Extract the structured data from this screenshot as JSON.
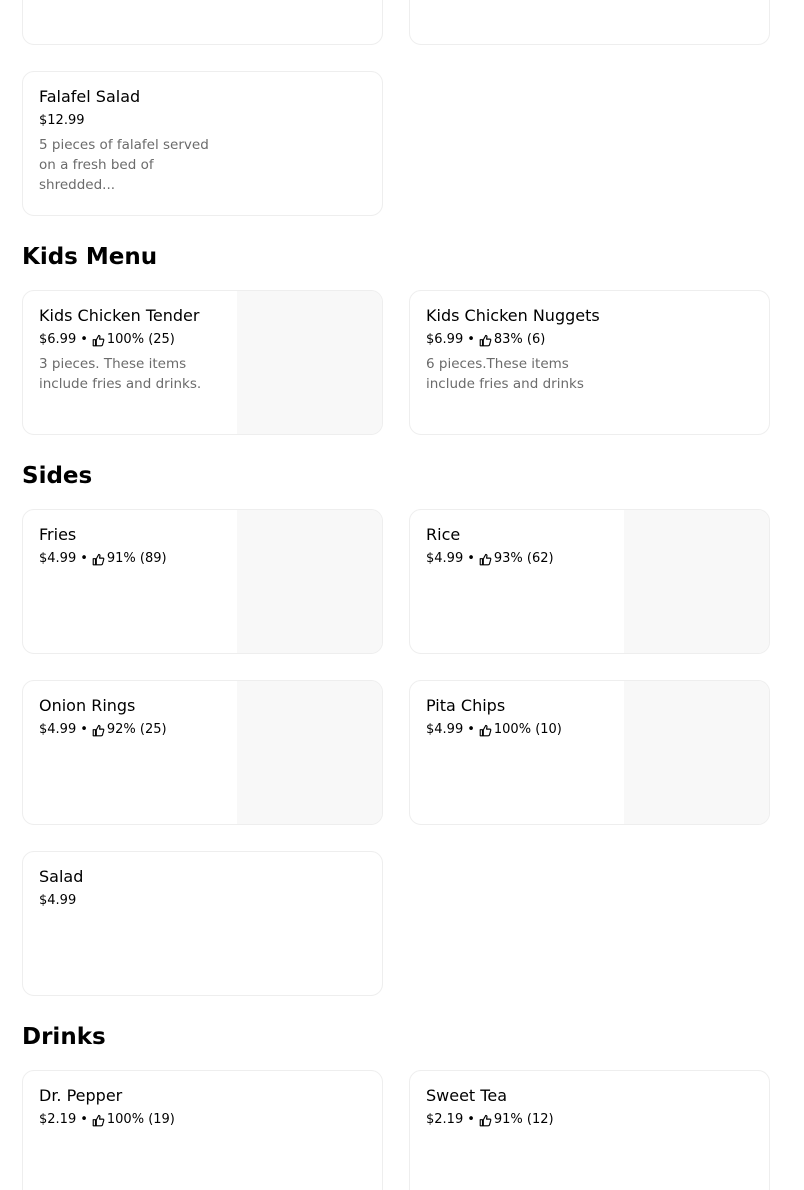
{
  "top_cards": {
    "left_cutoff_text": "",
    "right_cutoff_text": ""
  },
  "salads_extra": {
    "name": "Falafel Salad",
    "price": "$12.99",
    "description": "5 pieces of falafel served on a fresh bed of shredded..."
  },
  "sections": {
    "kids": {
      "title": "Kids Menu",
      "items": [
        {
          "name": "Kids Chicken Tender",
          "price": "$6.99",
          "sep": "•",
          "rating": "100% (25)",
          "description": "3 pieces. These items include fries and drinks."
        },
        {
          "name": "Kids Chicken Nuggets",
          "price": "$6.99",
          "sep": "•",
          "rating": "83% (6)",
          "description": "6 pieces.These items include fries and drinks"
        }
      ]
    },
    "sides": {
      "title": "Sides",
      "items": [
        {
          "name": "Fries",
          "price": "$4.99",
          "sep": "•",
          "rating": "91% (89)"
        },
        {
          "name": "Rice",
          "price": "$4.99",
          "sep": "•",
          "rating": "93% (62)"
        },
        {
          "name": "Onion Rings",
          "price": "$4.99",
          "sep": "•",
          "rating": "92% (25)"
        },
        {
          "name": "Pita Chips",
          "price": "$4.99",
          "sep": "•",
          "rating": "100% (10)"
        },
        {
          "name": "Salad",
          "price": "$4.99"
        }
      ]
    },
    "drinks": {
      "title": "Drinks",
      "items": [
        {
          "name": "Dr. Pepper",
          "price": "$2.19",
          "sep": "•",
          "rating": "100% (19)"
        },
        {
          "name": "Sweet Tea",
          "price": "$2.19",
          "sep": "•",
          "rating": "91% (12)"
        }
      ]
    }
  },
  "icons": {
    "rating": "thumbs-up-icon"
  },
  "colors": {
    "text_primary": "#000000",
    "text_secondary": "#6b6b6b",
    "card_border": "#eeeeee",
    "image_placeholder": "#f8f8f8"
  }
}
